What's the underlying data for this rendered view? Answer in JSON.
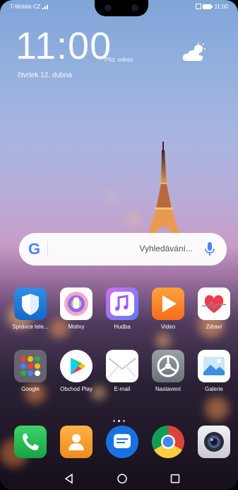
{
  "status": {
    "carrier": "T-Mobile CZ",
    "time": "11:00",
    "battery_icon": "battery-icon",
    "signal_icon": "signal-icon"
  },
  "lockscreen": {
    "clock": "11:00",
    "city": "Přid. město",
    "date": "čtvrtek 12. dubna",
    "weather_icon": "partly-cloudy-icon"
  },
  "search": {
    "logo": "G",
    "placeholder": "Vyhledávání..."
  },
  "apps_row1": [
    {
      "label": "Správce tele...",
      "icon": "shield-icon"
    },
    {
      "label": "Motivy",
      "icon": "brush-icon"
    },
    {
      "label": "Hudba",
      "icon": "music-note-icon"
    },
    {
      "label": "Video",
      "icon": "play-icon"
    },
    {
      "label": "Zdraví",
      "icon": "heart-icon"
    }
  ],
  "apps_row2": [
    {
      "label": "Google",
      "icon": "folder-icon"
    },
    {
      "label": "Obchod Play",
      "icon": "play-store-icon"
    },
    {
      "label": "E-mail",
      "icon": "envelope-icon"
    },
    {
      "label": "Nastavení",
      "icon": "gear-icon"
    },
    {
      "label": "Galerie",
      "icon": "gallery-icon"
    }
  ],
  "dock": [
    {
      "icon": "phone-icon"
    },
    {
      "icon": "contacts-icon"
    },
    {
      "icon": "messages-icon"
    },
    {
      "icon": "chrome-icon"
    },
    {
      "icon": "camera-icon"
    }
  ],
  "page_indicator": {
    "count": 3,
    "active": 2
  },
  "nav": {
    "back_icon": "back-icon",
    "home_icon": "home-icon",
    "recents_icon": "recents-icon"
  }
}
